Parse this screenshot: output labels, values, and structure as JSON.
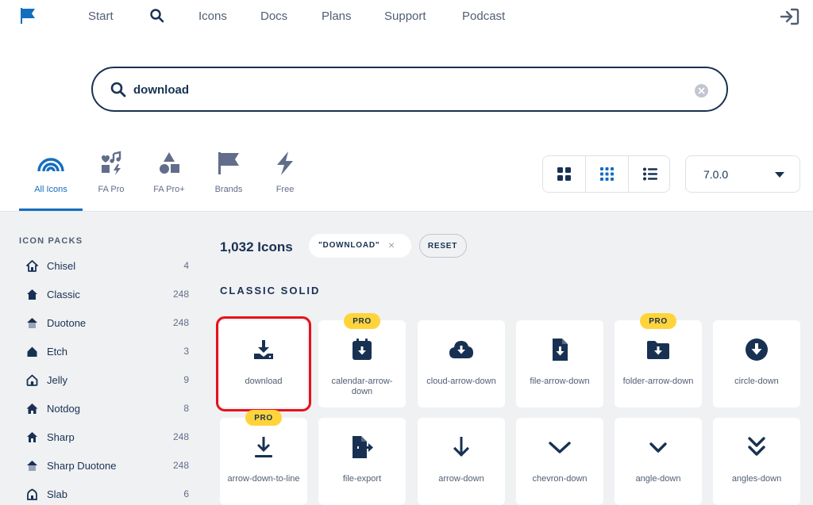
{
  "nav": {
    "items": [
      "Start",
      "Icons",
      "Docs",
      "Plans",
      "Support",
      "Podcast"
    ]
  },
  "search": {
    "value": "download",
    "placeholder": ""
  },
  "filter_tabs": [
    {
      "label": "All Icons",
      "active": true
    },
    {
      "label": "FA Pro",
      "active": false
    },
    {
      "label": "FA Pro+",
      "active": false
    },
    {
      "label": "Brands",
      "active": false
    },
    {
      "label": "Free",
      "active": false
    }
  ],
  "version": {
    "selected": "7.0.0"
  },
  "sidebar": {
    "title": "ICON PACKS",
    "packs": [
      {
        "name": "Chisel",
        "count": "4"
      },
      {
        "name": "Classic",
        "count": "248"
      },
      {
        "name": "Duotone",
        "count": "248"
      },
      {
        "name": "Etch",
        "count": "3"
      },
      {
        "name": "Jelly",
        "count": "9"
      },
      {
        "name": "Notdog",
        "count": "8"
      },
      {
        "name": "Sharp",
        "count": "248"
      },
      {
        "name": "Sharp Duotone",
        "count": "248"
      },
      {
        "name": "Slab",
        "count": "6"
      }
    ]
  },
  "results": {
    "count_label": "1,032 Icons",
    "query_chip": "\"DOWNLOAD\"",
    "reset_label": "RESET",
    "section_title": "CLASSIC SOLID",
    "pro_label": "PRO",
    "icons": [
      {
        "name": "download",
        "pro": false,
        "icon": "download-icon",
        "selected": true
      },
      {
        "name": "calendar-arrow-down",
        "pro": true,
        "icon": "calendar-arrow-down-icon"
      },
      {
        "name": "cloud-arrow-down",
        "pro": false,
        "icon": "cloud-arrow-down-icon"
      },
      {
        "name": "file-arrow-down",
        "pro": false,
        "icon": "file-arrow-down-icon"
      },
      {
        "name": "folder-arrow-down",
        "pro": true,
        "icon": "folder-arrow-down-icon"
      },
      {
        "name": "circle-down",
        "pro": false,
        "icon": "circle-down-icon"
      },
      {
        "name": "arrow-down-to-line",
        "pro": true,
        "icon": "arrow-down-to-line-icon"
      },
      {
        "name": "file-export",
        "pro": false,
        "icon": "file-export-icon"
      },
      {
        "name": "arrow-down",
        "pro": false,
        "icon": "arrow-down-icon"
      },
      {
        "name": "chevron-down",
        "pro": false,
        "icon": "chevron-down-icon"
      },
      {
        "name": "angle-down",
        "pro": false,
        "icon": "angle-down-icon"
      },
      {
        "name": "angles-down",
        "pro": false,
        "icon": "angles-down-icon"
      }
    ]
  },
  "colors": {
    "brand_navy": "#183153",
    "accent_blue": "#146ebe",
    "pro_yellow": "#ffd43b",
    "selection_red": "#e8101a",
    "background_grey": "#f0f1f3"
  }
}
